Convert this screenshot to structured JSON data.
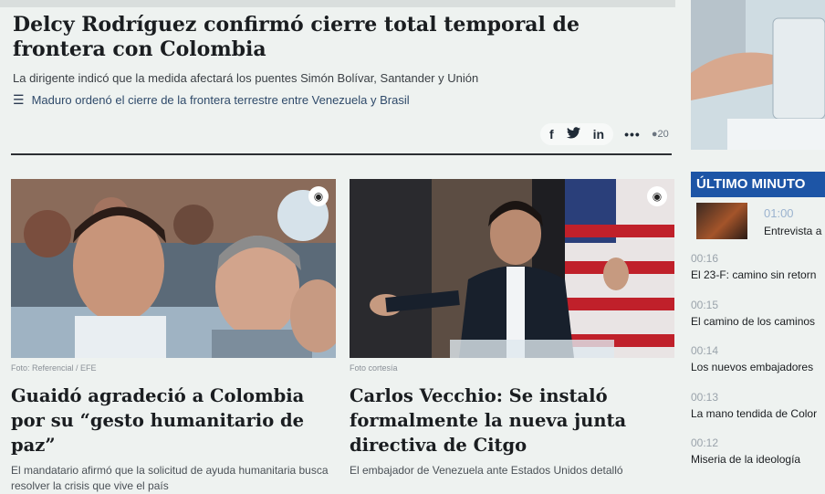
{
  "main": {
    "headline": "Delcy Rodríguez confirmó cierre total temporal de frontera con Colombia",
    "deck": "La dirigente indicó que la medida afectará los puentes Simón Bolívar, Santander y Unión",
    "related": "Maduro ordenó el cierre de la frontera terrestre entre Venezuela y Brasil",
    "share": {
      "facebook": "f",
      "twitter": "twitter-icon",
      "linkedin": "in",
      "more": "•••",
      "comments": "20"
    }
  },
  "cards": [
    {
      "credit": "Foto: Referencial / EFE",
      "title": "Guaidó agradeció a Colombia por su “gesto humanitario de paz”",
      "text": "El mandatario afirmó que la solicitud de ayuda humanitaria busca resolver la crisis que vive el país"
    },
    {
      "credit": "Foto cortesía",
      "title": "Carlos Vecchio: Se instaló formalmente la nueva junta directiva de Citgo",
      "text": "El embajador de Venezuela ante Estados Unidos detalló"
    }
  ],
  "sidebar": {
    "ultimo_label": "ÚLTIMO MINUTO",
    "first": {
      "time": "01:00",
      "text": "Entrevista a"
    },
    "items": [
      {
        "time": "00:16",
        "text": "El 23-F: camino sin retorn"
      },
      {
        "time": "00:15",
        "text": "El camino de los caminos"
      },
      {
        "time": "00:14",
        "text": "Los nuevos embajadores"
      },
      {
        "time": "00:13",
        "text": "La mano tendida de Color"
      },
      {
        "time": "00:12",
        "text": "Miseria de la ideología"
      }
    ]
  },
  "colors": {
    "accent": "#1d55a6",
    "headline": "#1a1d20",
    "link": "#2f4a6a"
  }
}
